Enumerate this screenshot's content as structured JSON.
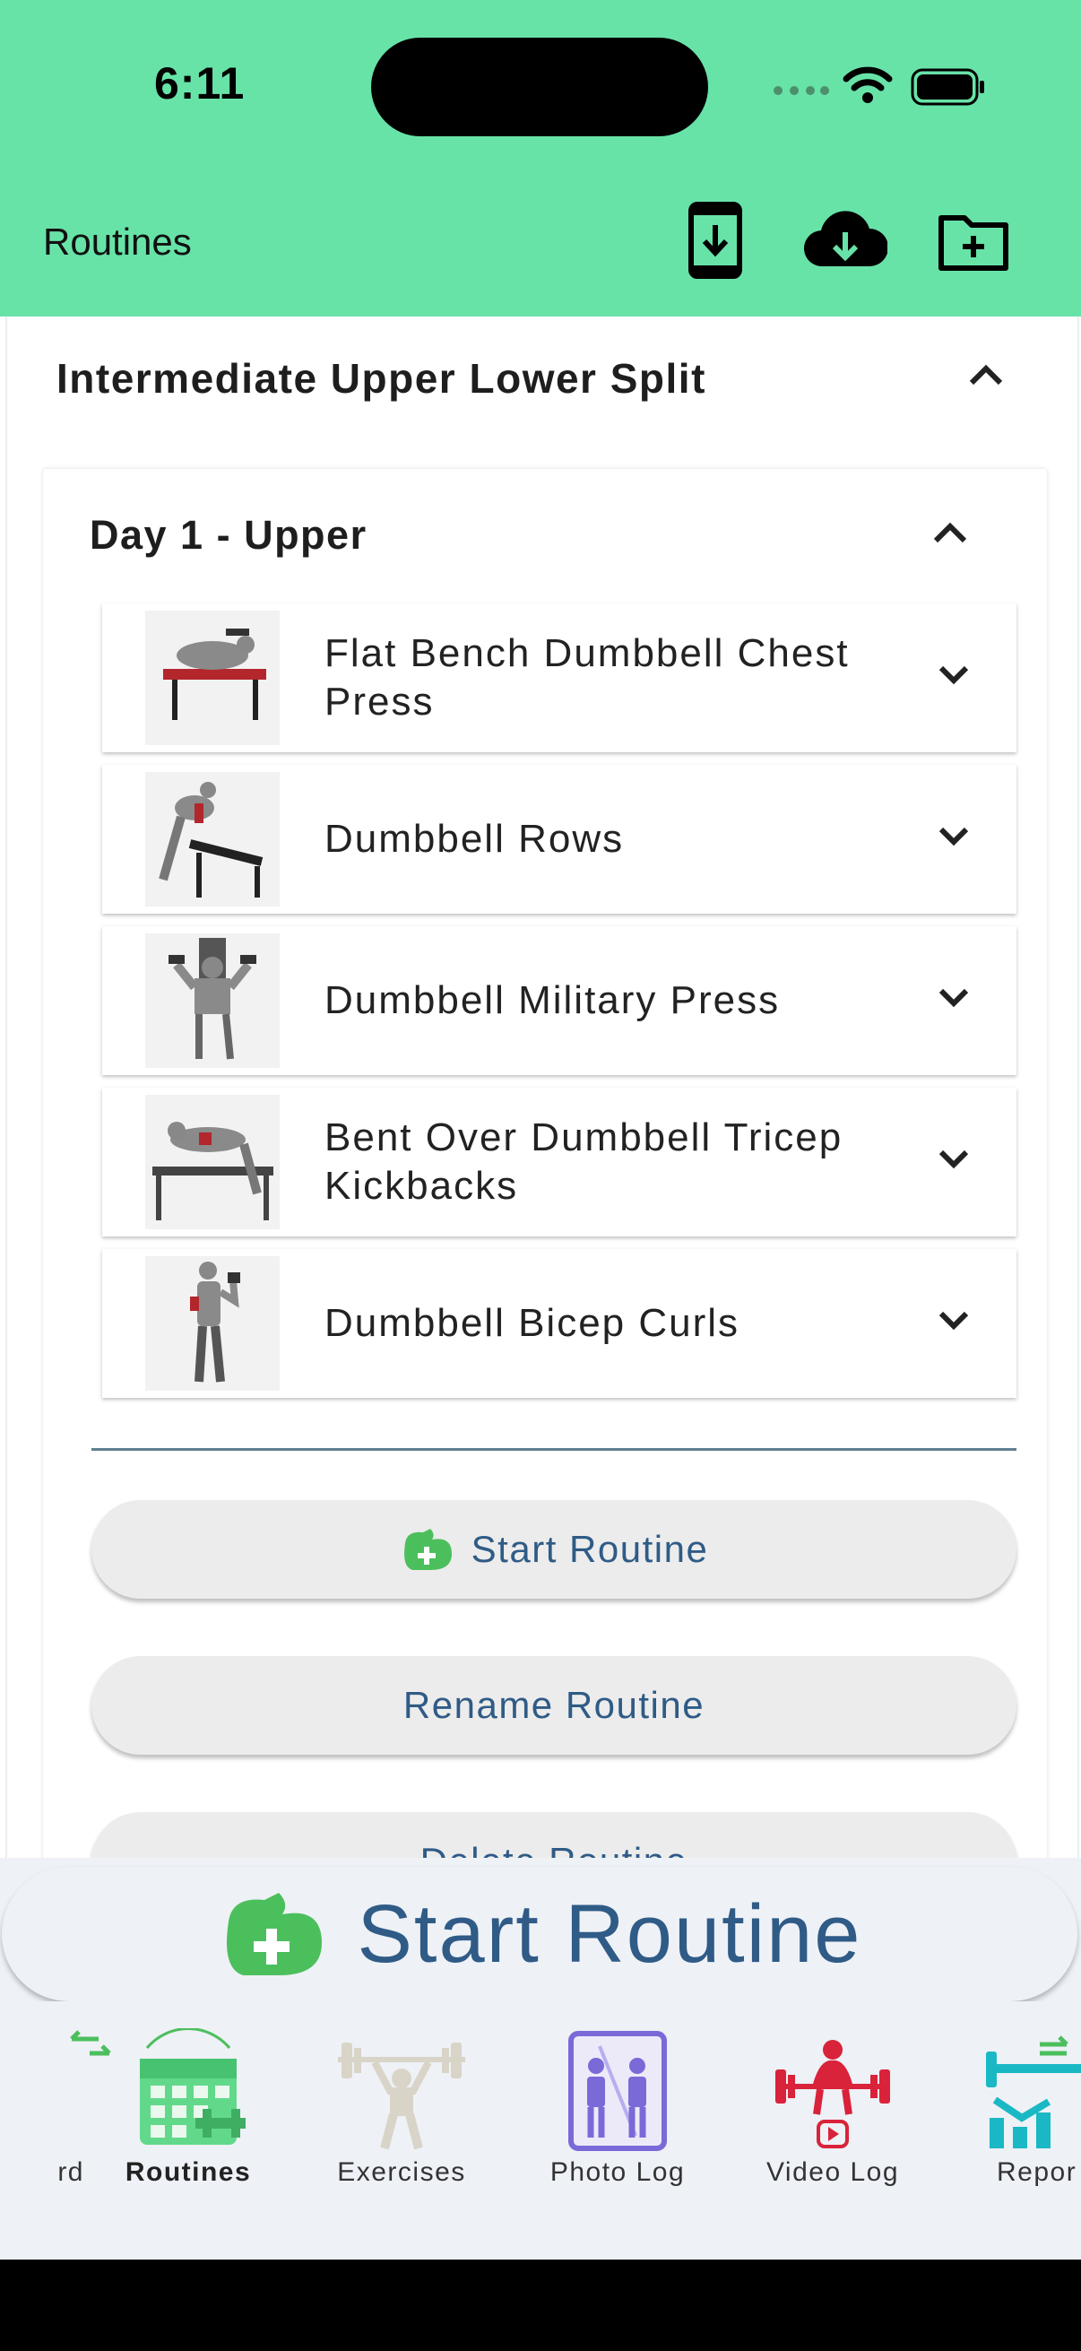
{
  "status": {
    "time": "6:11"
  },
  "header": {
    "title": "Routines",
    "bg": "#68e3a8"
  },
  "routine": {
    "name": "Intermediate Upper Lower Split",
    "day": {
      "title": "Day 1 - Upper",
      "exercises": [
        {
          "name": "Flat Bench Dumbbell Chest Press"
        },
        {
          "name": "Dumbbell Rows"
        },
        {
          "name": "Dumbbell Military Press"
        },
        {
          "name": "Bent Over Dumbbell Tricep Kickbacks"
        },
        {
          "name": "Dumbbell Bicep Curls"
        }
      ],
      "start_label": "Start Routine",
      "rename_label": "Rename Routine",
      "delete_label": "Delete Routine"
    }
  },
  "big_start": {
    "label": "Start Routine"
  },
  "nav": {
    "items": [
      {
        "label": "rd",
        "icon": "dashboard-icon"
      },
      {
        "label": "Routines",
        "icon": "calendar-icon",
        "active": true
      },
      {
        "label": "Exercises",
        "icon": "weightlifter-icon"
      },
      {
        "label": "Photo Log",
        "icon": "mirror-photo-icon"
      },
      {
        "label": "Video Log",
        "icon": "deadlift-video-icon"
      },
      {
        "label": "Repor",
        "icon": "report-chart-icon"
      }
    ]
  },
  "colors": {
    "accent_text": "#2f5b86",
    "green": "#4cbf5d",
    "red": "#d8233a",
    "purple": "#7a6ad8",
    "teal": "#1ab8c4"
  }
}
